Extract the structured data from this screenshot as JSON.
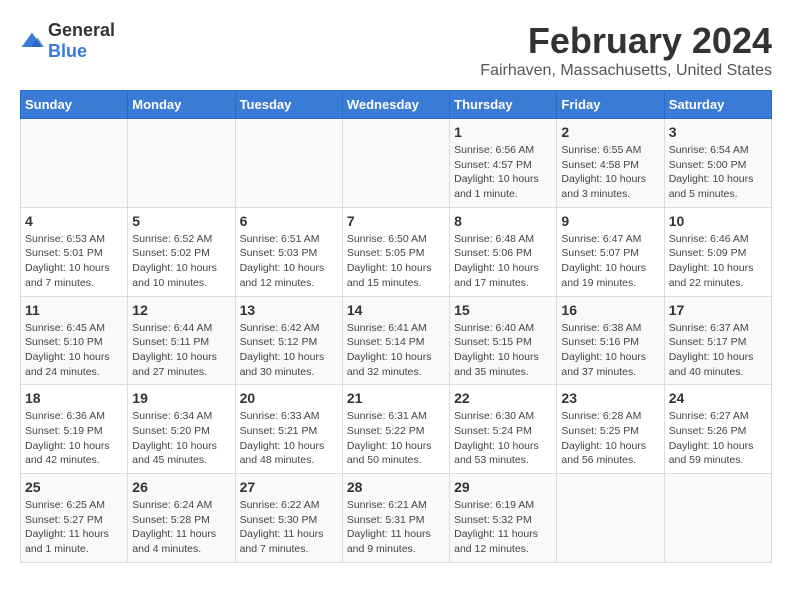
{
  "logo": {
    "text_general": "General",
    "text_blue": "Blue"
  },
  "title": "February 2024",
  "subtitle": "Fairhaven, Massachusetts, United States",
  "days_of_week": [
    "Sunday",
    "Monday",
    "Tuesday",
    "Wednesday",
    "Thursday",
    "Friday",
    "Saturday"
  ],
  "weeks": [
    [
      {
        "day": "",
        "info": ""
      },
      {
        "day": "",
        "info": ""
      },
      {
        "day": "",
        "info": ""
      },
      {
        "day": "",
        "info": ""
      },
      {
        "day": "1",
        "info": "Sunrise: 6:56 AM\nSunset: 4:57 PM\nDaylight: 10 hours and 1 minute."
      },
      {
        "day": "2",
        "info": "Sunrise: 6:55 AM\nSunset: 4:58 PM\nDaylight: 10 hours and 3 minutes."
      },
      {
        "day": "3",
        "info": "Sunrise: 6:54 AM\nSunset: 5:00 PM\nDaylight: 10 hours and 5 minutes."
      }
    ],
    [
      {
        "day": "4",
        "info": "Sunrise: 6:53 AM\nSunset: 5:01 PM\nDaylight: 10 hours and 7 minutes."
      },
      {
        "day": "5",
        "info": "Sunrise: 6:52 AM\nSunset: 5:02 PM\nDaylight: 10 hours and 10 minutes."
      },
      {
        "day": "6",
        "info": "Sunrise: 6:51 AM\nSunset: 5:03 PM\nDaylight: 10 hours and 12 minutes."
      },
      {
        "day": "7",
        "info": "Sunrise: 6:50 AM\nSunset: 5:05 PM\nDaylight: 10 hours and 15 minutes."
      },
      {
        "day": "8",
        "info": "Sunrise: 6:48 AM\nSunset: 5:06 PM\nDaylight: 10 hours and 17 minutes."
      },
      {
        "day": "9",
        "info": "Sunrise: 6:47 AM\nSunset: 5:07 PM\nDaylight: 10 hours and 19 minutes."
      },
      {
        "day": "10",
        "info": "Sunrise: 6:46 AM\nSunset: 5:09 PM\nDaylight: 10 hours and 22 minutes."
      }
    ],
    [
      {
        "day": "11",
        "info": "Sunrise: 6:45 AM\nSunset: 5:10 PM\nDaylight: 10 hours and 24 minutes."
      },
      {
        "day": "12",
        "info": "Sunrise: 6:44 AM\nSunset: 5:11 PM\nDaylight: 10 hours and 27 minutes."
      },
      {
        "day": "13",
        "info": "Sunrise: 6:42 AM\nSunset: 5:12 PM\nDaylight: 10 hours and 30 minutes."
      },
      {
        "day": "14",
        "info": "Sunrise: 6:41 AM\nSunset: 5:14 PM\nDaylight: 10 hours and 32 minutes."
      },
      {
        "day": "15",
        "info": "Sunrise: 6:40 AM\nSunset: 5:15 PM\nDaylight: 10 hours and 35 minutes."
      },
      {
        "day": "16",
        "info": "Sunrise: 6:38 AM\nSunset: 5:16 PM\nDaylight: 10 hours and 37 minutes."
      },
      {
        "day": "17",
        "info": "Sunrise: 6:37 AM\nSunset: 5:17 PM\nDaylight: 10 hours and 40 minutes."
      }
    ],
    [
      {
        "day": "18",
        "info": "Sunrise: 6:36 AM\nSunset: 5:19 PM\nDaylight: 10 hours and 42 minutes."
      },
      {
        "day": "19",
        "info": "Sunrise: 6:34 AM\nSunset: 5:20 PM\nDaylight: 10 hours and 45 minutes."
      },
      {
        "day": "20",
        "info": "Sunrise: 6:33 AM\nSunset: 5:21 PM\nDaylight: 10 hours and 48 minutes."
      },
      {
        "day": "21",
        "info": "Sunrise: 6:31 AM\nSunset: 5:22 PM\nDaylight: 10 hours and 50 minutes."
      },
      {
        "day": "22",
        "info": "Sunrise: 6:30 AM\nSunset: 5:24 PM\nDaylight: 10 hours and 53 minutes."
      },
      {
        "day": "23",
        "info": "Sunrise: 6:28 AM\nSunset: 5:25 PM\nDaylight: 10 hours and 56 minutes."
      },
      {
        "day": "24",
        "info": "Sunrise: 6:27 AM\nSunset: 5:26 PM\nDaylight: 10 hours and 59 minutes."
      }
    ],
    [
      {
        "day": "25",
        "info": "Sunrise: 6:25 AM\nSunset: 5:27 PM\nDaylight: 11 hours and 1 minute."
      },
      {
        "day": "26",
        "info": "Sunrise: 6:24 AM\nSunset: 5:28 PM\nDaylight: 11 hours and 4 minutes."
      },
      {
        "day": "27",
        "info": "Sunrise: 6:22 AM\nSunset: 5:30 PM\nDaylight: 11 hours and 7 minutes."
      },
      {
        "day": "28",
        "info": "Sunrise: 6:21 AM\nSunset: 5:31 PM\nDaylight: 11 hours and 9 minutes."
      },
      {
        "day": "29",
        "info": "Sunrise: 6:19 AM\nSunset: 5:32 PM\nDaylight: 11 hours and 12 minutes."
      },
      {
        "day": "",
        "info": ""
      },
      {
        "day": "",
        "info": ""
      }
    ]
  ]
}
